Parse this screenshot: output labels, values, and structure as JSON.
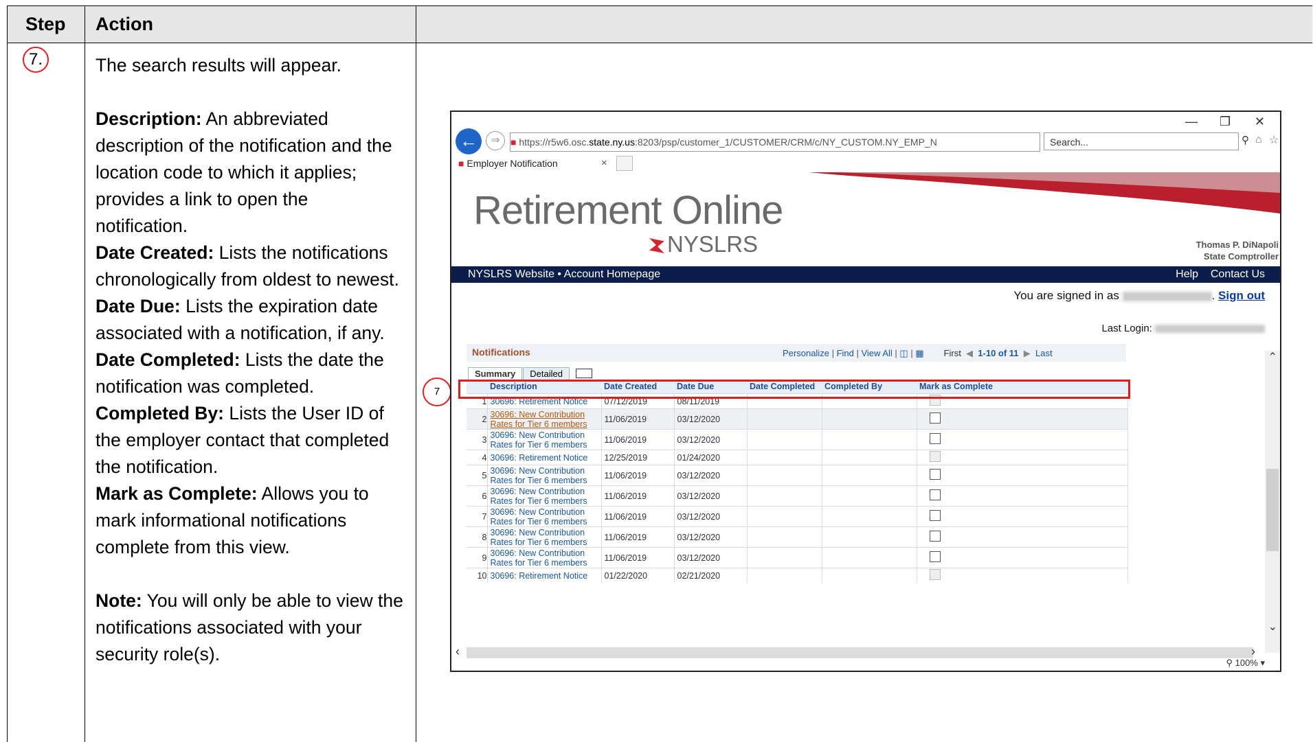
{
  "table": {
    "header_step": "Step",
    "header_action": "Action",
    "step_number": "7."
  },
  "doc": {
    "intro": "The search results will appear.",
    "items": [
      {
        "term": "Description:",
        "text": " An abbreviated description of the notification and the location code to which it applies; provides a link to open the notification."
      },
      {
        "term": "Date Created:",
        "text": " Lists the notifications chronologically from oldest to newest."
      },
      {
        "term": "Date Due:",
        "text": " Lists the expiration date associated with a notification, if any."
      },
      {
        "term": "Date Completed:",
        "text": " Lists the date the notification was completed."
      },
      {
        "term": "Completed By:",
        "text": "  Lists the User ID of the employer contact that completed the notification."
      },
      {
        "term": "Mark as Complete:",
        "text": " Allows you to mark informational notifications complete from this view."
      }
    ],
    "note_term": "Note:",
    "note_text": " You will only be able to view the notifications associated with your security role(s)."
  },
  "browser": {
    "url_prefix": "https://r5w6.osc.",
    "url_host": "state.ny.us",
    "url_rest": ":8203/psp/customer_1/CUSTOMER/CRM/c/NY_CUSTOM.NY_EMP_N",
    "search_placeholder": "Search...",
    "tab_title": "Employer Notification",
    "zoom": "100%"
  },
  "site": {
    "logo_title": "Retirement Online",
    "logo_sub": "NYSLRS",
    "comptroller_name": "Thomas P. DiNapoli",
    "comptroller_title": "State Comptroller",
    "nav_left": "NYSLRS Website  •  Account Homepage",
    "nav_help": "Help",
    "nav_contact": "Contact Us",
    "signed_in": "You are signed in as",
    "sign_out": "Sign out",
    "last_login": "Last Login:"
  },
  "grid": {
    "title": "Notifications",
    "personalize": "Personalize",
    "find": "Find",
    "view_all": "View All",
    "first": "First",
    "range": "1-10 of 11",
    "last": "Last",
    "tab_summary": "Summary",
    "tab_detailed": "Detailed",
    "columns": [
      "Description",
      "Date Created",
      "Date Due",
      "Date Completed",
      "Completed By",
      "Mark as Complete"
    ],
    "rows": [
      {
        "n": "1",
        "desc": "30696: Retirement Notice",
        "created": "07/12/2019",
        "due": "08/11/2019",
        "enabled": false
      },
      {
        "n": "2",
        "desc": "30696: New Contribution Rates for Tier 6 members",
        "created": "11/06/2019",
        "due": "03/12/2020",
        "enabled": true
      },
      {
        "n": "3",
        "desc": "30696: New Contribution Rates for Tier 6 members",
        "created": "11/06/2019",
        "due": "03/12/2020",
        "enabled": true
      },
      {
        "n": "4",
        "desc": "30696: Retirement Notice",
        "created": "12/25/2019",
        "due": "01/24/2020",
        "enabled": false
      },
      {
        "n": "5",
        "desc": "30696: New Contribution Rates for Tier 6 members",
        "created": "11/06/2019",
        "due": "03/12/2020",
        "enabled": true
      },
      {
        "n": "6",
        "desc": "30696: New Contribution Rates for Tier 6 members",
        "created": "11/06/2019",
        "due": "03/12/2020",
        "enabled": true
      },
      {
        "n": "7",
        "desc": "30696: New Contribution Rates for Tier 6 members",
        "created": "11/06/2019",
        "due": "03/12/2020",
        "enabled": true
      },
      {
        "n": "8",
        "desc": "30696: New Contribution Rates for Tier 6 members",
        "created": "11/06/2019",
        "due": "03/12/2020",
        "enabled": true
      },
      {
        "n": "9",
        "desc": "30696: New Contribution Rates for Tier 6 members",
        "created": "11/06/2019",
        "due": "03/12/2020",
        "enabled": true
      },
      {
        "n": "10",
        "desc": "30696: Retirement Notice",
        "created": "01/22/2020",
        "due": "02/21/2020",
        "enabled": false
      }
    ],
    "callout_label": "7"
  },
  "colors": {
    "accent_red": "#e02020",
    "nav_bg": "#0b1e4b",
    "link_blue": "#1a58a0"
  }
}
